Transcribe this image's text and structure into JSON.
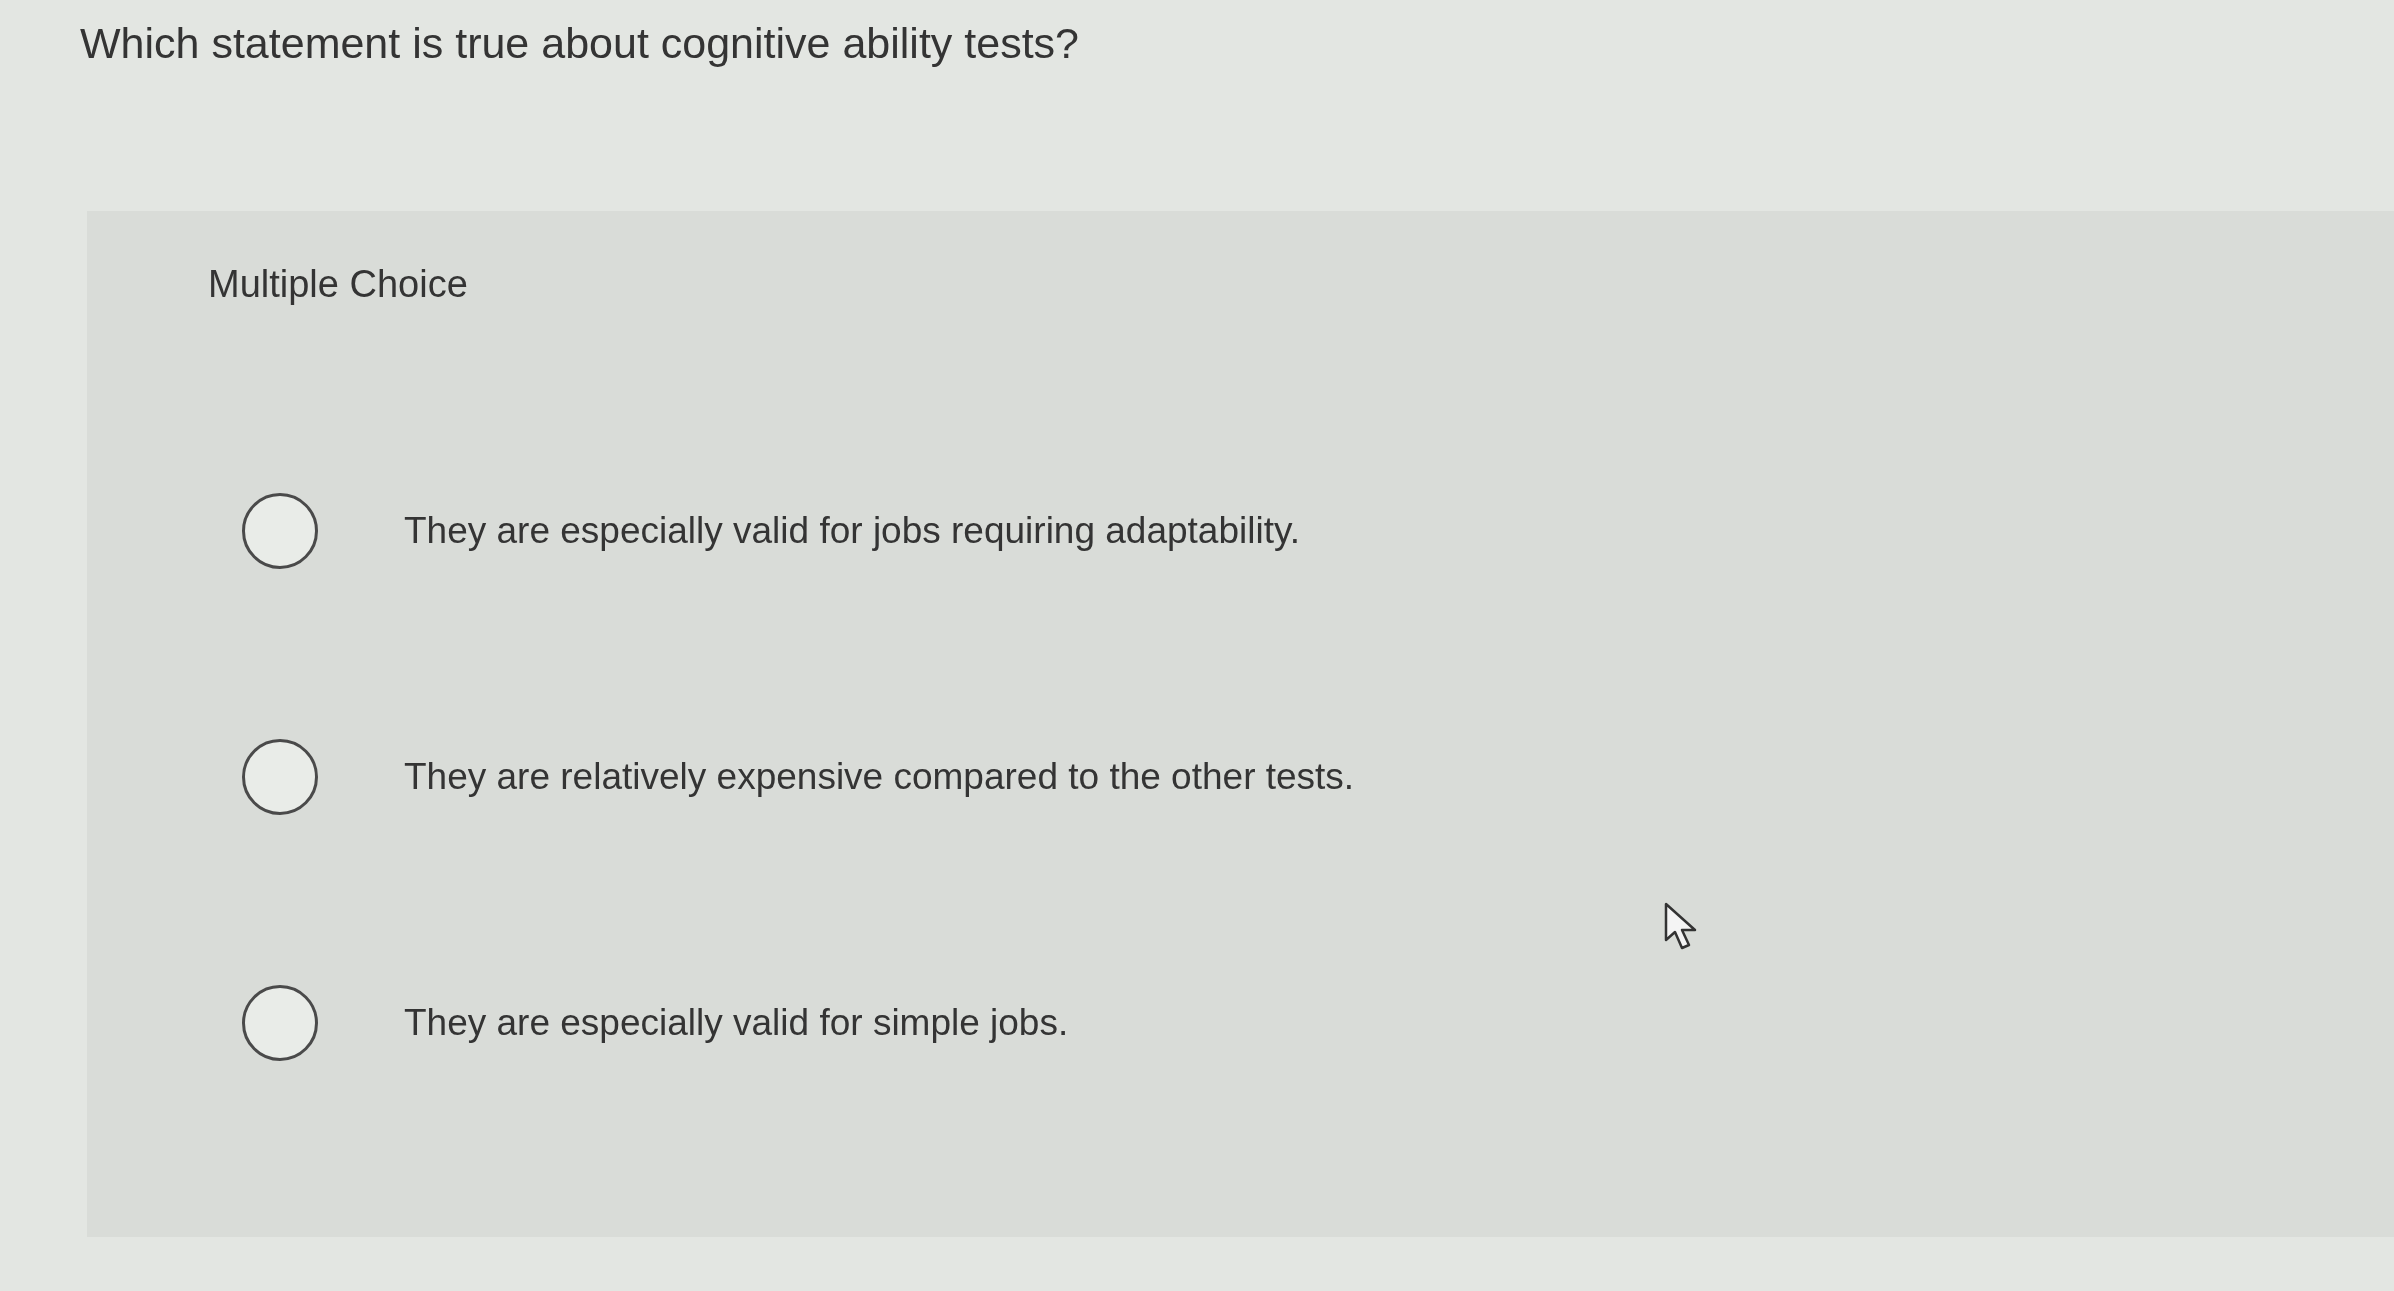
{
  "question": "Which statement is true about cognitive ability tests?",
  "panel": {
    "heading": "Multiple Choice",
    "options": [
      {
        "label": "They are especially valid for jobs requiring adaptability.",
        "selected": false
      },
      {
        "label": "They are relatively expensive compared to the other tests.",
        "selected": false
      },
      {
        "label": "They are especially valid for simple jobs.",
        "selected": false
      }
    ]
  }
}
